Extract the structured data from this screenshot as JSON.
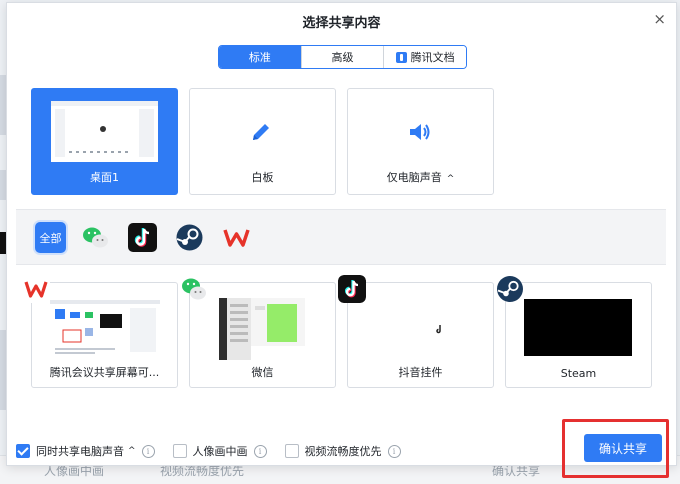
{
  "dialog": {
    "title": "选择共享内容",
    "close_glyph": "×"
  },
  "tabs": [
    {
      "label": "标准",
      "active": true
    },
    {
      "label": "高级",
      "active": false
    },
    {
      "label": "腾讯文档",
      "active": false,
      "icon": "tencent-docs-icon"
    }
  ],
  "share_cards": [
    {
      "label": "桌面1",
      "selected": true,
      "icon": "desktop-thumbnail"
    },
    {
      "label": "白板",
      "selected": false,
      "icon": "pen-icon"
    },
    {
      "label": "仅电脑声音",
      "selected": false,
      "icon": "speaker-icon",
      "caret": "^"
    }
  ],
  "filter": {
    "all_label": "全部",
    "apps": [
      "wechat-icon",
      "tiktok-icon",
      "steam-icon",
      "wps-icon"
    ]
  },
  "app_windows": [
    {
      "label": "腾讯会议共享屏幕可...",
      "icon": "wps-icon"
    },
    {
      "label": "微信",
      "icon": "wechat-icon"
    },
    {
      "label": "抖音挂件",
      "icon": "tiktok-icon"
    },
    {
      "label": "Steam",
      "icon": "steam-icon"
    }
  ],
  "options": [
    {
      "label": "同时共享电脑声音",
      "checked": true,
      "caret": "^"
    },
    {
      "label": "人像画中画",
      "checked": false
    },
    {
      "label": "视频流畅度优先",
      "checked": false
    }
  ],
  "confirm_label": "确认共享",
  "colors": {
    "accent": "#2f7bf4",
    "highlight": "#e53030"
  },
  "background": {
    "bottom_texts": [
      "人像画中画",
      "视频流畅度优先",
      "确认共享"
    ]
  }
}
